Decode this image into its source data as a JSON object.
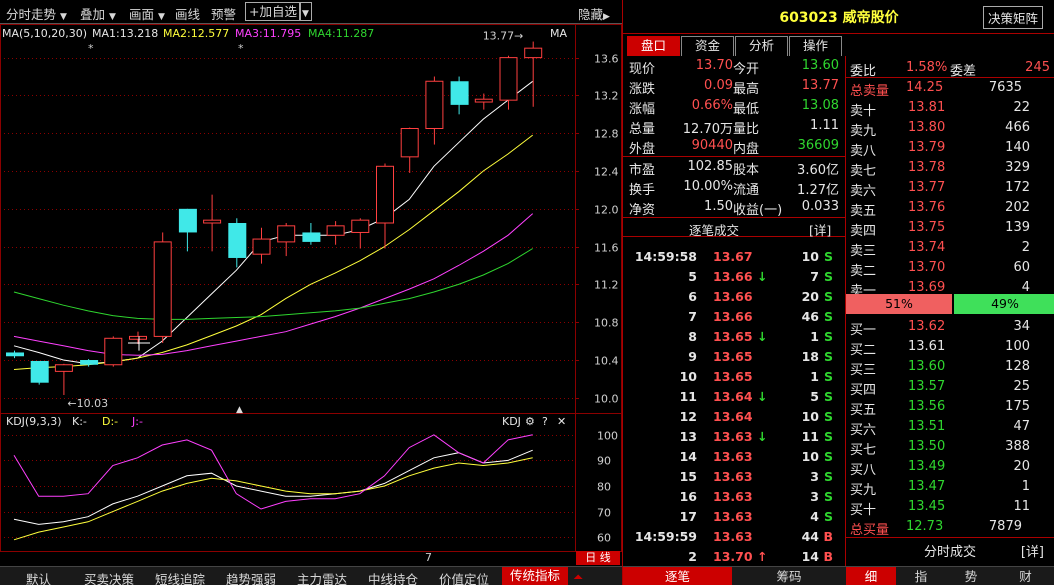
{
  "toolbar": {
    "items": [
      "分时走势",
      "叠加",
      "画面",
      "画线",
      "预警"
    ],
    "add_watch": "加自选",
    "hide": "隐藏"
  },
  "ma_legend": {
    "label": "MA(5,10,20,30)",
    "ma1": "MA1:13.218",
    "ma2": "MA2:12.577",
    "ma3": "MA3:11.795",
    "ma4": "MA4:11.287",
    "right": "MA"
  },
  "kdj_legend": {
    "label": "KDJ(9,3,3)",
    "k": "K:-",
    "d": "D:-",
    "j": "J:-",
    "right": "KDJ"
  },
  "chart_data": {
    "type": "candlestick",
    "price_axis": {
      "ylim": [
        9.85,
        13.85
      ],
      "ticks": [
        13.6,
        13.2,
        12.8,
        12.4,
        12.0,
        11.6,
        11.2,
        10.8,
        10.4,
        10.0
      ]
    },
    "kdj_axis": {
      "ylim": [
        55,
        105
      ],
      "ticks": [
        100,
        90,
        80,
        70,
        60
      ]
    },
    "annotations": {
      "high": "13.77",
      "low": "10.03"
    },
    "date_label": "7",
    "period_label": "日 线",
    "candles": [
      {
        "o": 10.48,
        "c": 10.44,
        "h": 10.5,
        "l": 10.42
      },
      {
        "o": 10.39,
        "c": 10.16,
        "h": 10.39,
        "l": 10.14
      },
      {
        "o": 10.28,
        "c": 10.35,
        "h": 10.36,
        "l": 10.03
      },
      {
        "o": 10.4,
        "c": 10.35,
        "h": 10.41,
        "l": 10.33
      },
      {
        "o": 10.35,
        "c": 10.63,
        "h": 10.65,
        "l": 10.33
      },
      {
        "o": 10.62,
        "c": 10.65,
        "h": 10.7,
        "l": 10.57
      },
      {
        "o": 10.65,
        "c": 11.65,
        "h": 11.75,
        "l": 10.58
      },
      {
        "o": 12.0,
        "c": 11.75,
        "h": 12.0,
        "l": 11.55
      },
      {
        "o": 11.85,
        "c": 11.88,
        "h": 12.15,
        "l": 11.55
      },
      {
        "o": 11.85,
        "c": 11.48,
        "h": 11.9,
        "l": 11.38
      },
      {
        "o": 11.52,
        "c": 11.68,
        "h": 11.8,
        "l": 11.42
      },
      {
        "o": 11.65,
        "c": 11.82,
        "h": 11.85,
        "l": 11.5
      },
      {
        "o": 11.75,
        "c": 11.65,
        "h": 11.85,
        "l": 11.62
      },
      {
        "o": 11.72,
        "c": 11.82,
        "h": 11.87,
        "l": 11.62
      },
      {
        "o": 11.75,
        "c": 11.88,
        "h": 11.9,
        "l": 11.58
      },
      {
        "o": 11.85,
        "c": 12.45,
        "h": 12.48,
        "l": 11.58
      },
      {
        "o": 12.55,
        "c": 12.85,
        "h": 12.86,
        "l": 12.38
      },
      {
        "o": 12.85,
        "c": 13.35,
        "h": 13.4,
        "l": 12.68
      },
      {
        "o": 13.35,
        "c": 13.1,
        "h": 13.4,
        "l": 13.0
      },
      {
        "o": 13.13,
        "c": 13.16,
        "h": 13.22,
        "l": 13.05
      },
      {
        "o": 13.15,
        "c": 13.6,
        "h": 13.62,
        "l": 13.05
      },
      {
        "o": 13.6,
        "c": 13.7,
        "h": 13.77,
        "l": 13.08
      }
    ],
    "ma_series": [
      {
        "name": "MA1",
        "values": [
          10.55,
          10.48,
          10.4,
          10.36,
          10.38,
          10.42,
          10.6,
          10.85,
          11.1,
          11.35,
          11.65,
          11.72,
          11.72,
          11.72,
          11.78,
          11.9,
          12.1,
          12.45,
          12.7,
          12.95,
          13.15,
          13.35
        ]
      },
      {
        "name": "MA2",
        "values": [
          10.3,
          10.32,
          10.33,
          10.35,
          10.38,
          10.42,
          10.48,
          10.56,
          10.66,
          10.76,
          10.88,
          11.05,
          11.2,
          11.32,
          11.45,
          11.6,
          11.78,
          11.98,
          12.18,
          12.4,
          12.58,
          12.78
        ]
      },
      {
        "name": "MA3",
        "values": [
          10.65,
          10.6,
          10.55,
          10.5,
          10.46,
          10.45,
          10.46,
          10.5,
          10.55,
          10.6,
          10.65,
          10.7,
          10.78,
          10.86,
          10.95,
          11.05,
          11.15,
          11.26,
          11.4,
          11.55,
          11.72,
          11.95
        ]
      },
      {
        "name": "MA4",
        "values": [
          11.12,
          11.05,
          10.98,
          10.92,
          10.87,
          10.84,
          10.83,
          10.83,
          10.84,
          10.85,
          10.86,
          10.88,
          10.9,
          10.92,
          10.95,
          11.0,
          11.05,
          11.12,
          11.2,
          11.3,
          11.42,
          11.58
        ]
      }
    ],
    "kdj_series": [
      {
        "name": "K",
        "values": [
          67,
          65,
          66,
          68,
          73,
          76,
          80,
          84,
          85,
          80,
          78,
          76,
          76,
          77,
          78,
          81,
          86,
          91,
          93,
          89,
          90,
          94
        ]
      },
      {
        "name": "D",
        "values": [
          59,
          62,
          64,
          66,
          70,
          74,
          78,
          81,
          83,
          82,
          80,
          78,
          77,
          77,
          78,
          80,
          84,
          87,
          89,
          88,
          89,
          91
        ]
      },
      {
        "name": "J",
        "values": [
          92,
          76,
          76,
          77,
          88,
          91,
          96,
          98,
          94,
          77,
          71,
          74,
          75,
          75,
          77,
          84,
          95,
          100,
          93,
          89,
          98,
          100
        ]
      }
    ]
  },
  "stock": {
    "code": "603023",
    "name": "威帝股价",
    "decision": "决策矩阵"
  },
  "tabs": [
    "盘口",
    "资金",
    "分析",
    "操作"
  ],
  "quote": [
    [
      "现价",
      "13.70",
      "今开",
      "13.60"
    ],
    [
      "涨跌",
      "0.09",
      "最高",
      "13.77"
    ],
    [
      "涨幅",
      "0.66%",
      "最低",
      "13.08"
    ],
    [
      "总量",
      "12.70万",
      "量比",
      "1.11"
    ],
    [
      "外盘",
      "90440",
      "内盘",
      "36609"
    ],
    [
      "市盈",
      "102.85",
      "股本",
      "3.60亿"
    ],
    [
      "换手",
      "10.00%",
      "流通",
      "1.27亿"
    ],
    [
      "净资",
      "1.50",
      "收益(一)",
      "0.033"
    ]
  ],
  "ticks_title": "逐笔成交",
  "ticks_detail": "[详]",
  "ticks": [
    {
      "t": "14:59:58",
      "p": "13.67",
      "arrow": "",
      "v": "10",
      "s": "S"
    },
    {
      "t": "5",
      "p": "13.66",
      "arrow": "↓",
      "v": "7",
      "s": "S"
    },
    {
      "t": "6",
      "p": "13.66",
      "arrow": "",
      "v": "20",
      "s": "S"
    },
    {
      "t": "7",
      "p": "13.66",
      "arrow": "",
      "v": "46",
      "s": "S"
    },
    {
      "t": "8",
      "p": "13.65",
      "arrow": "↓",
      "v": "1",
      "s": "S"
    },
    {
      "t": "9",
      "p": "13.65",
      "arrow": "",
      "v": "18",
      "s": "S"
    },
    {
      "t": "10",
      "p": "13.65",
      "arrow": "",
      "v": "1",
      "s": "S"
    },
    {
      "t": "11",
      "p": "13.64",
      "arrow": "↓",
      "v": "5",
      "s": "S"
    },
    {
      "t": "12",
      "p": "13.64",
      "arrow": "",
      "v": "10",
      "s": "S"
    },
    {
      "t": "13",
      "p": "13.63",
      "arrow": "↓",
      "v": "11",
      "s": "S"
    },
    {
      "t": "14",
      "p": "13.63",
      "arrow": "",
      "v": "10",
      "s": "S"
    },
    {
      "t": "15",
      "p": "13.63",
      "arrow": "",
      "v": "3",
      "s": "S"
    },
    {
      "t": "16",
      "p": "13.63",
      "arrow": "",
      "v": "3",
      "s": "S"
    },
    {
      "t": "17",
      "p": "13.63",
      "arrow": "",
      "v": "4",
      "s": "S"
    },
    {
      "t": "14:59:59",
      "p": "13.63",
      "arrow": "",
      "v": "44",
      "s": "B"
    },
    {
      "t": "2",
      "p": "13.70",
      "arrow": "↑",
      "v": "14",
      "s": "B"
    }
  ],
  "book": {
    "weibi_label": "委比",
    "weibi": "1.58%",
    "weicha_label": "委差",
    "weicha": "245",
    "sell_total_label": "总卖量",
    "sell_total_price": "14.25",
    "sell_total_vol": "7635",
    "sells": [
      [
        "卖十",
        "13.81",
        "22"
      ],
      [
        "卖九",
        "13.80",
        "466"
      ],
      [
        "卖八",
        "13.79",
        "140"
      ],
      [
        "卖七",
        "13.78",
        "329"
      ],
      [
        "卖六",
        "13.77",
        "172"
      ],
      [
        "卖五",
        "13.76",
        "202"
      ],
      [
        "卖四",
        "13.75",
        "139"
      ],
      [
        "卖三",
        "13.74",
        "2"
      ],
      [
        "卖二",
        "13.70",
        "60"
      ],
      [
        "卖一",
        "13.69",
        "4"
      ]
    ],
    "ratio_sell": "51%",
    "ratio_buy": "49%",
    "ratio_sell_value": 0.51,
    "buys": [
      [
        "买一",
        "13.62",
        "34"
      ],
      [
        "买二",
        "13.61",
        "100"
      ],
      [
        "买三",
        "13.60",
        "128"
      ],
      [
        "买四",
        "13.57",
        "25"
      ],
      [
        "买五",
        "13.56",
        "175"
      ],
      [
        "买六",
        "13.51",
        "47"
      ],
      [
        "买七",
        "13.50",
        "388"
      ],
      [
        "买八",
        "13.49",
        "20"
      ],
      [
        "买九",
        "13.47",
        "1"
      ],
      [
        "买十",
        "13.45",
        "11"
      ]
    ],
    "buy_total_label": "总买量",
    "buy_total_price": "12.73",
    "buy_total_vol": "7879",
    "minute_label": "分时成交",
    "minute_detail": "[详]"
  },
  "bottom_tabs": [
    "默认",
    "买卖决策",
    "短线追踪",
    "趋势强弱",
    "主力雷达",
    "中线持仓",
    "价值定位",
    "传统指标"
  ],
  "right_bottom_tabs": [
    "逐笔",
    "筹码",
    "细",
    "指",
    "势",
    "财"
  ],
  "colors": {
    "up": "#ff5050",
    "down": "#2fd62f",
    "ma1": "#ffffff",
    "ma2": "#ffff3c",
    "ma3": "#ff40ff",
    "ma4": "#2fd62f",
    "grid": "#8b0000"
  }
}
